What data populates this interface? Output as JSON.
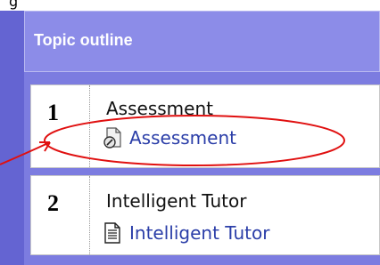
{
  "header_text": "g",
  "outline": {
    "title": "Topic outline"
  },
  "sections": [
    {
      "number": "1",
      "title": "Assessment",
      "link_label": "Assessment",
      "link_icon": "quiz-icon"
    },
    {
      "number": "2",
      "title": "Intelligent Tutor",
      "link_label": "Intelligent Tutor",
      "link_icon": "page-icon"
    }
  ],
  "colors": {
    "panel": "#6464d2",
    "header": "#8c8ce8",
    "link": "#2b3ea8",
    "annotation": "#e01010"
  }
}
